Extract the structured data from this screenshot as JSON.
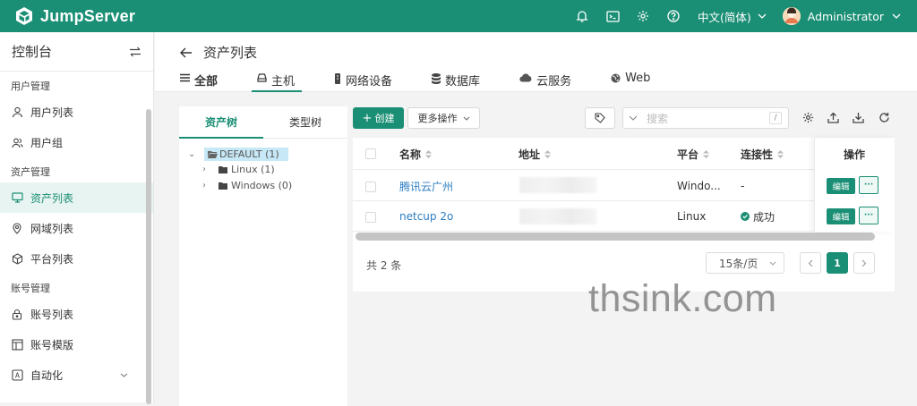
{
  "colors": {
    "brand": "#1b8f75",
    "link": "#2d7ec3",
    "selected_node_bg": "#c7e8f6"
  },
  "topbar": {
    "logo_text": "JumpServer",
    "language": "中文(简体)",
    "username": "Administrator",
    "icons": [
      "bell-icon",
      "terminal-icon",
      "gear-icon",
      "help-icon"
    ]
  },
  "sidebar": {
    "title": "控制台",
    "groups": {
      "users": "用户管理",
      "assets": "资产管理",
      "accounts": "账号管理"
    },
    "items": {
      "user_list": "用户列表",
      "user_group": "用户组",
      "asset_list": "资产列表",
      "domain_list": "网域列表",
      "platform_list": "平台列表",
      "account_list": "账号列表",
      "account_template": "账号模版",
      "automation": "自动化"
    },
    "active": "asset_list"
  },
  "page": {
    "title": "资产列表",
    "tabs": [
      "全部",
      "主机",
      "网络设备",
      "数据库",
      "云服务",
      "Web"
    ],
    "active_tab": "主机"
  },
  "tree": {
    "tabs": [
      "资产树",
      "类型树"
    ],
    "active_tab": "资产树",
    "nodes": {
      "root": "DEFAULT (1)",
      "linux": "Linux (1)",
      "windows": "Windows (0)"
    }
  },
  "toolbar": {
    "create_label": "创建",
    "more_label": "更多操作",
    "search_placeholder": "搜索",
    "search_shortcut": "/"
  },
  "table": {
    "headers": {
      "name": "名称",
      "address": "地址",
      "platform": "平台",
      "connectivity": "连接性",
      "actions": "操作"
    },
    "rows": [
      {
        "name": "腾讯云广州",
        "address": "",
        "platform": "Windo...",
        "connectivity": "-",
        "edit": "编辑",
        "more": "···"
      },
      {
        "name": "netcup 2o",
        "address": "",
        "platform": "Linux",
        "connectivity": "成功",
        "edit": "编辑",
        "more": "···"
      }
    ]
  },
  "pagination": {
    "total_text": "共 2 条",
    "page_size": "15条/页",
    "current_page": "1"
  },
  "watermark": "thsink.com"
}
